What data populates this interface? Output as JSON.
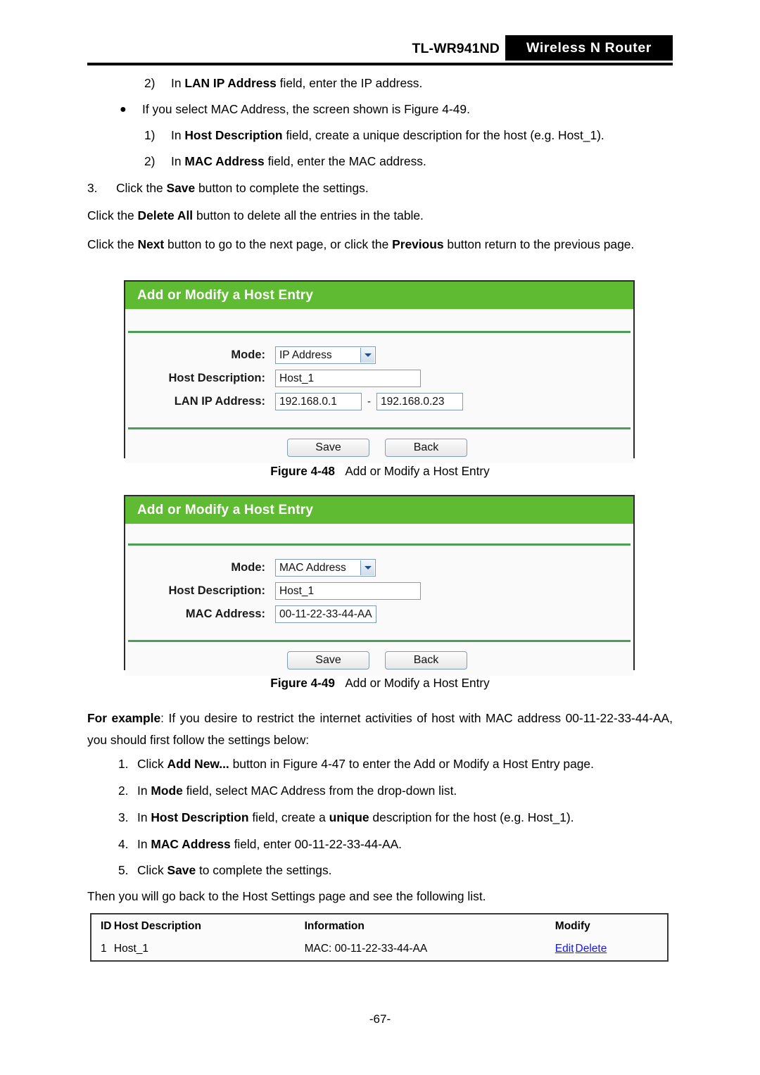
{
  "header": {
    "model": "TL-WR941ND",
    "brand": "Wireless N Router"
  },
  "body_text": {
    "step_2_lan": {
      "num": "2)",
      "pre": "In ",
      "bold": "LAN IP Address",
      "post": " field, enter the IP address."
    },
    "bullet_mac": {
      "dot": "●",
      "text": "If you select MAC Address, the screen shown is Figure 4-49."
    },
    "sub_1": {
      "num": "1)",
      "pre": "In ",
      "bold": "Host Description",
      "post": " field, create a unique description for the host (e.g. Host_1)."
    },
    "sub_2": {
      "num": "2)",
      "pre": "In ",
      "bold": "MAC Address",
      "post": " field, enter the MAC address."
    },
    "step_3": {
      "num": "3.",
      "pre": "Click the ",
      "bold": "Save",
      "post": " button to complete the settings."
    },
    "para_delete_all": {
      "pre": "Click the ",
      "bold": "Delete All",
      "post": " button to delete all the entries in the table."
    },
    "para_next_prev": {
      "pre": "Click the ",
      "bold1": "Next",
      "mid": " button to go to the next page, or click the ",
      "bold2": "Previous",
      "post": " button return to the previous page."
    },
    "for_example": {
      "bold": "For example",
      "line1": ": If you desire to restrict the internet activities of host with MAC address",
      "line2": "00-11-22-33-44-AA, you should first follow the settings below:"
    },
    "ex_1": {
      "num": "1.",
      "pre": "Click ",
      "bold": "Add New...",
      "post": " button in Figure 4-47 to enter the Add or Modify a Host Entry page."
    },
    "ex_2": {
      "num": "2.",
      "pre": "In ",
      "bold": "Mode",
      "post": " field, select MAC Address from the drop-down list."
    },
    "ex_3": {
      "num": "3.",
      "pre": "In ",
      "bold": "Host Description",
      "mid": " field, create a ",
      "bold2": "unique",
      "post": " description for the host (e.g. Host_1)."
    },
    "ex_4": {
      "num": "4.",
      "pre": "In ",
      "bold": "MAC Address",
      "post": " field, enter 00-11-22-33-44-AA."
    },
    "ex_5": {
      "num": "5.",
      "pre": "Click ",
      "bold": "Save",
      "post": " to complete the settings."
    },
    "para_then": "Then you will go back to the Host Settings page and see the following list."
  },
  "figure_ip": {
    "panel_title": "Add or Modify a Host Entry",
    "labels": {
      "mode": "Mode:",
      "host_description": "Host Description:",
      "lan_ip_address": "LAN IP Address:"
    },
    "values": {
      "mode": "IP Address",
      "host_description": "Host_1",
      "lan_ip_start": "192.168.0.1",
      "lan_ip_separator": "-",
      "lan_ip_end": "192.168.0.23"
    },
    "buttons": {
      "save": "Save",
      "back": "Back"
    },
    "caption_no": "Figure 4-48",
    "caption_text": "Add or Modify a Host Entry"
  },
  "figure_mac": {
    "panel_title": "Add or Modify a Host Entry",
    "labels": {
      "mode": "Mode:",
      "host_description": "Host Description:",
      "mac_address": "MAC Address:"
    },
    "values": {
      "mode": "MAC Address",
      "host_description": "Host_1",
      "mac_address": "00-11-22-33-44-AA"
    },
    "buttons": {
      "save": "Save",
      "back": "Back"
    },
    "caption_no": "Figure 4-49",
    "caption_text": "Add or Modify a Host Entry"
  },
  "result_table": {
    "headers": {
      "id": "ID",
      "description": "Host Description",
      "information": "Information",
      "modify": "Modify"
    },
    "rows": [
      {
        "id": "1",
        "description": "Host_1",
        "information": "MAC: 00-11-22-33-44-AA",
        "edit": "Edit",
        "delete": "Delete"
      }
    ]
  },
  "footer": {
    "page_number": "-67-"
  },
  "colors": {
    "panel_green": "#5fbb32",
    "divider_green": "#4a9d54",
    "link_blue": "#1414ff",
    "header_black": "#000000",
    "input_border": "#7f9db9"
  }
}
